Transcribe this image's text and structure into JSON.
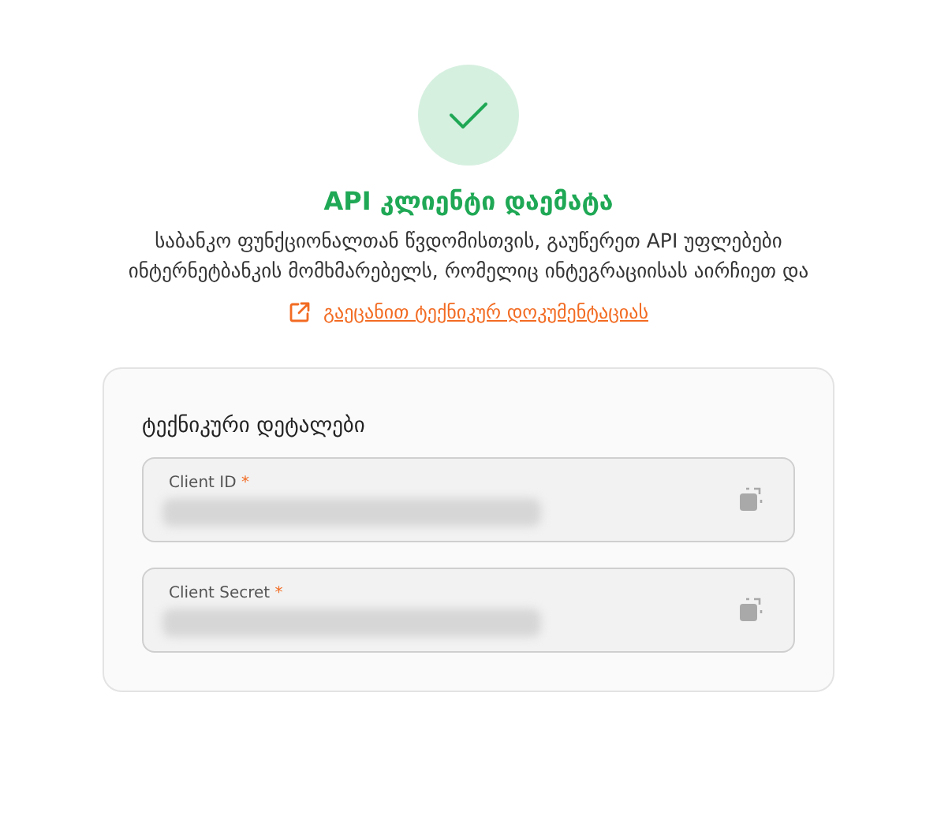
{
  "status": {
    "kind": "success",
    "title": "API კლიენტი დაემატა",
    "description": "საბანკო ფუნქციონალთან წვდომისთვის, გაუწერეთ API უფლებები ინტერნეტბანკის მომხმარებელს, რომელიც ინტეგრაციისას აირჩიეთ და",
    "link": "გაეცანით ტექნიკურ დოკუმენტაციას"
  },
  "details": {
    "title": "ტექნიკური დეტალები",
    "fields": [
      {
        "label": "Client ID",
        "required_mark": "*",
        "masked": true
      },
      {
        "label": "Client Secret",
        "required_mark": "*",
        "masked": true
      }
    ]
  }
}
